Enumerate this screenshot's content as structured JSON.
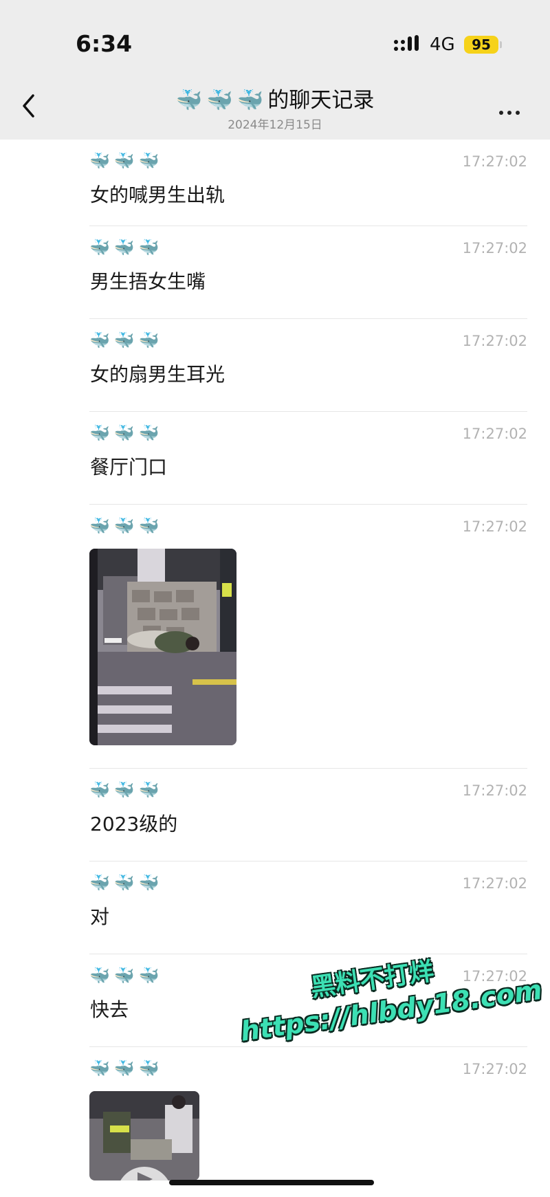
{
  "status_bar": {
    "time": "6:34",
    "network": "4G",
    "battery": "95"
  },
  "header": {
    "sender_emoji": "🐳🐳🐳",
    "title_suffix": "的聊天记录",
    "date": "2024年12月15日"
  },
  "messages": [
    {
      "sender": "🐳🐳🐳",
      "time": "17:27:02",
      "text": "女的喊男生出轨"
    },
    {
      "sender": "🐳🐳🐳",
      "time": "17:27:02",
      "text": "男生捂女生嘴"
    },
    {
      "sender": "🐳🐳🐳",
      "time": "17:27:02",
      "text": "女的扇男生耳光"
    },
    {
      "sender": "🐳🐳🐳",
      "time": "17:27:02",
      "text": "餐厅门口"
    },
    {
      "sender": "🐳🐳🐳",
      "time": "17:27:02",
      "type": "image"
    },
    {
      "sender": "🐳🐳🐳",
      "time": "17:27:02",
      "text": "2023级的"
    },
    {
      "sender": "🐳🐳🐳",
      "time": "17:27:02",
      "text": "对"
    },
    {
      "sender": "🐳🐳🐳",
      "time": "17:27:02",
      "text": "快去"
    },
    {
      "sender": "🐳🐳🐳",
      "time": "17:27:02",
      "type": "video"
    }
  ],
  "watermark": {
    "line1": "黑料不打烊",
    "line2": "https://hlbdy18.com"
  },
  "colors": {
    "header_bg": "#ededed",
    "battery": "#f6d21a",
    "watermark": "#3ce0b4",
    "timestamp": "#b2b2b2"
  }
}
